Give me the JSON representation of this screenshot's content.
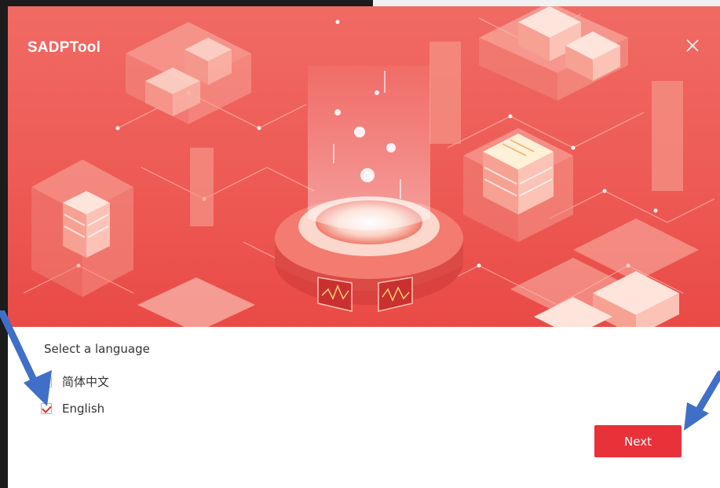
{
  "window": {
    "title": "SADPTool",
    "close_icon": "close-icon"
  },
  "language": {
    "prompt": "Select a language",
    "options": [
      {
        "label": "简体中文",
        "checked": false
      },
      {
        "label": "English",
        "checked": true
      }
    ]
  },
  "actions": {
    "next_label": "Next"
  },
  "colors": {
    "banner": "#ee5a55",
    "accent": "#e9313a",
    "check": "#e02c2c",
    "annotation_arrow": "#3f6fc6"
  },
  "annotations": {
    "arrow_icon": "arrow-annotation-icon"
  }
}
